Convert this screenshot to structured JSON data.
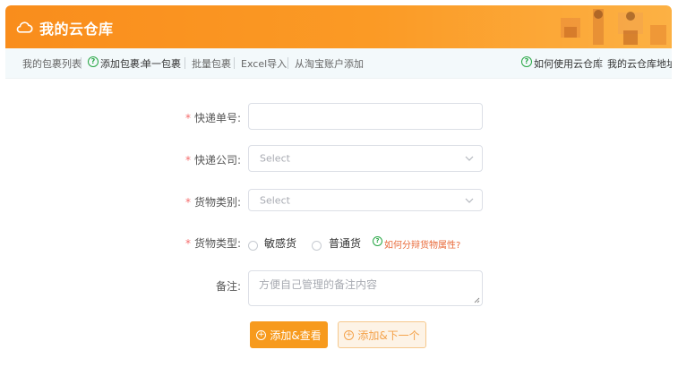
{
  "header": {
    "title": "我的云仓库",
    "brand_color": "#f98d1c"
  },
  "nav": {
    "my_packages": "我的包裹列表",
    "add_package_label": "添加包裹:",
    "single_package": "单一包裹",
    "batch_package": "批量包裹",
    "excel_import": "Excel导入",
    "taobao_add": "从淘宝账户添加",
    "how_to_use": "如何使用云仓库",
    "warehouse_address": "我的云仓库地址"
  },
  "form": {
    "required_mark": "*",
    "tracking_no": {
      "label": "快递单号:",
      "value": ""
    },
    "courier": {
      "label": "快递公司:",
      "placeholder": "Select"
    },
    "goods_category": {
      "label": "货物类别:",
      "placeholder": "Select"
    },
    "goods_type": {
      "label": "货物类型:",
      "options": [
        "敏感货",
        "普通货"
      ],
      "help_text": "如何分辩货物属性?"
    },
    "note": {
      "label": "备注:",
      "placeholder": "方便自己管理的备注内容"
    }
  },
  "buttons": {
    "add_view": "添加&查看",
    "add_next": "添加&下一个"
  }
}
